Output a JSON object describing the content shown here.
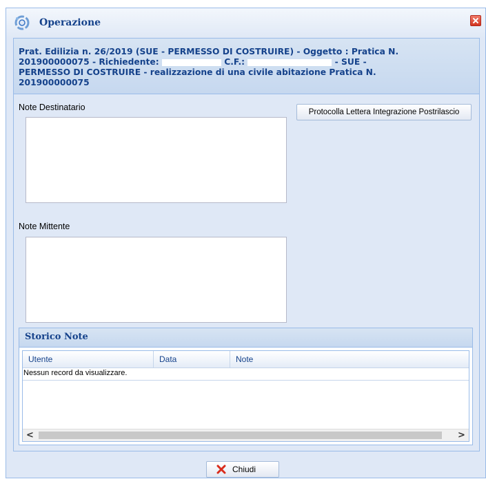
{
  "window": {
    "title": "Operazione",
    "title_icon": "gear-refresh-icon",
    "close_icon": "close-icon"
  },
  "header": {
    "line1": "Prat. Edilizia n. 26/2019 (SUE - PERMESSO DI COSTRUIRE) - Oggetto : Pratica N.",
    "line2_a": "201900000075 - Richiedente: ",
    "line2_b": " C.F.: ",
    "line2_c": " - SUE -",
    "line3": "PERMESSO DI COSTRUIRE - realizzazione di una civile abitazione Pratica N.",
    "line4": "201900000075"
  },
  "form": {
    "note_destinatario_label": "Note Destinatario",
    "note_destinatario_value": "",
    "note_mittente_label": "Note Mittente",
    "note_mittente_value": "",
    "protocolla_button": "Protocolla Lettera Integrazione Postrilascio"
  },
  "storico": {
    "title": "Storico Note",
    "columns": [
      "Utente",
      "Data",
      "Note"
    ],
    "empty_message": "Nessun record da visualizzare.",
    "scroll_left": "<",
    "scroll_right": ">"
  },
  "footer": {
    "close_button": "Chiudi",
    "close_button_icon": "red-x-icon"
  }
}
